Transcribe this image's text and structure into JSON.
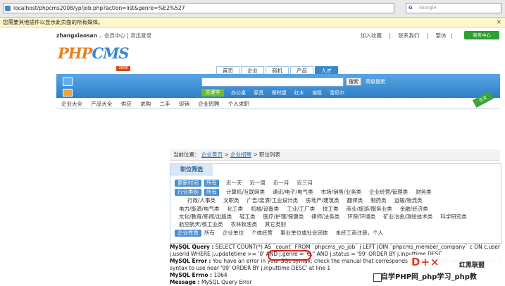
{
  "browser": {
    "url": "localhost/phpcms2008/yp/job.php?action=list&genre=%E2%527",
    "search_placeholder": "Google"
  },
  "plugin_bar": {
    "text": "您需要其他插件以显示此页面的所有媒体。"
  },
  "header": {
    "username": "zhangxiaosan",
    "member_center": "会员中心",
    "logout": "退出登录",
    "top_links": [
      "加入收藏",
      "联系我们",
      "繁体"
    ],
    "green_button": "商务中心"
  },
  "logo": {
    "part1": "PHP",
    "part2": "CMS",
    "sub": "2008"
  },
  "nav_tabs": [
    "首页",
    "企业",
    "商机",
    "产品",
    "人才"
  ],
  "search": {
    "button": "搜索",
    "advanced": "高级搜索",
    "hot_label": "关键字",
    "hot_words": [
      "办公桌",
      "家具",
      "保时捷",
      "红木",
      "地毯",
      "雪尼尔"
    ],
    "corner_badge": "企业"
  },
  "category_bar": [
    "企业大全",
    "产品大全",
    "供应",
    "求购",
    "二手",
    "促销",
    "企业招聘",
    "个人求职"
  ],
  "breadcrumb": {
    "prefix": "当前位置：",
    "items": [
      "企业黄页",
      "企业招聘",
      "职位列表"
    ]
  },
  "filter": {
    "title": "职位筛选",
    "all_label": "所有",
    "time_label": "更新时间",
    "time_options": [
      "近一天",
      "近一周",
      "近一月",
      "近三月"
    ],
    "industry_label": "行业类别",
    "industry_rows": [
      [
        "计算机/互联网类",
        "通讯/电子/电气类",
        "市场/销售/业务类",
        "企业经营/管理类",
        "财务类"
      ],
      [
        "行政/人事类",
        "文职类",
        "广告/装潢/工业设计类",
        "房地产/建筑类",
        "翻译类",
        "制药类",
        "运输/物流类"
      ],
      [
        "电力/能源/电气类",
        "化工类",
        "机械/设备类",
        "工业/工厂类",
        "技工类",
        "商业/旅游/服务业类",
        "金融/经济类"
      ],
      [
        "文化/教育/新闻/出版类",
        "轻工类",
        "医疗/护理/保健类",
        "律师/法务类",
        "环保/环境类",
        "矿业冶金/测绘技术类",
        "科学研究类"
      ],
      [
        "航空航天/核工业类",
        "农林牧渔类",
        "其它类别"
      ]
    ],
    "nature_label": "企业性质",
    "nature_options": [
      "所有",
      "企业单位",
      "个体经营",
      "事业单位或社会团体",
      "未经工商注册，个人"
    ]
  },
  "error": {
    "query_label": "MySQL Query :",
    "query_line1": "SELECT COUNT(*) AS `count` FROM `phpcms_yp_job` j LEFT JOIN `phpcms_member_company` c ON c.userid =",
    "query_line2": "j.userid WHERE j.updatetime >= '0' AND j.genre = '€\\'' AND j.status = '99' ORDER BY j.inputtime DESC",
    "error_label": "MySQL Error :",
    "error_line1": "You have an error in your SQL syntax; check the manual that corresponds to your MySQL server version for the right",
    "error_line2": "syntax to use near '99' ORDER BY j.inputtime DESC' at line 1",
    "errno_label": "MySQL Errno :",
    "errno": "1064",
    "message_label": "Message :",
    "message": "MySQL Query Error"
  },
  "watermark": {
    "logo": "D+×",
    "logo_text": "红黑联盟",
    "bottom": "自学PHP网_php学习_php教"
  }
}
